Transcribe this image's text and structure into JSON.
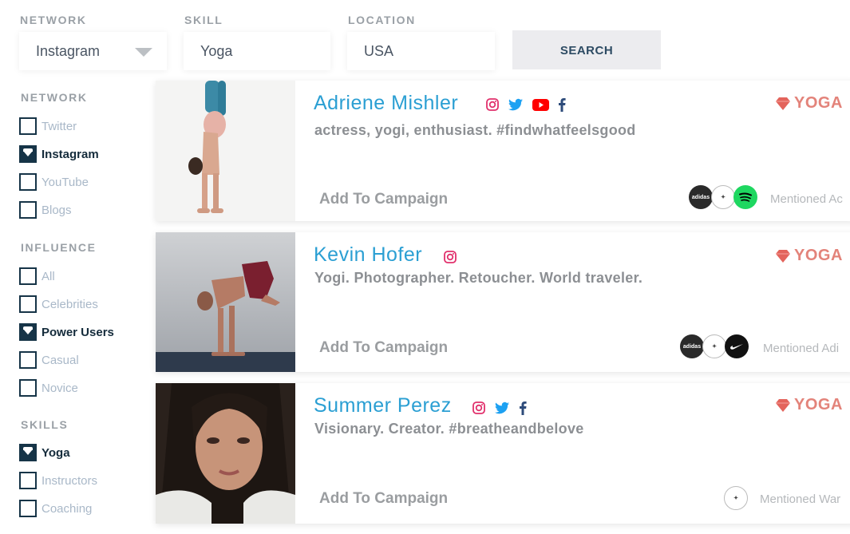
{
  "search": {
    "network_label": "NETWORK",
    "network_value": "Instagram",
    "skill_label": "SKILL",
    "skill_value": "Yoga",
    "location_label": "LOCATION",
    "location_value": "USA",
    "search_button": "SEARCH"
  },
  "sidebar": {
    "network": {
      "title": "NETWORK",
      "items": [
        {
          "label": "Twitter",
          "checked": false
        },
        {
          "label": "Instagram",
          "checked": true
        },
        {
          "label": "YouTube",
          "checked": false
        },
        {
          "label": "Blogs",
          "checked": false
        }
      ]
    },
    "influence": {
      "title": "INFLUENCE",
      "items": [
        {
          "label": "All",
          "checked": false
        },
        {
          "label": "Celebrities",
          "checked": false
        },
        {
          "label": "Power Users",
          "checked": true
        },
        {
          "label": "Casual",
          "checked": false
        },
        {
          "label": "Novice",
          "checked": false
        }
      ]
    },
    "skills": {
      "title": "SKILLS",
      "items": [
        {
          "label": "Yoga",
          "checked": true
        },
        {
          "label": "Instructors",
          "checked": false
        },
        {
          "label": "Coaching",
          "checked": false
        }
      ]
    }
  },
  "cards": [
    {
      "name": "Adriene Mishler",
      "bio": "actress, yogi, enthusiast. #findwhatfeelsgood",
      "tag": "YOGA",
      "add_label": "Add To Campaign",
      "mentioned": "Mentioned Ac",
      "socials": [
        "instagram-icon",
        "twitter-icon",
        "youtube-icon",
        "facebook-icon"
      ],
      "brands": [
        "adidas-logo",
        "brand-seal-logo",
        "spotify-logo"
      ]
    },
    {
      "name": "Kevin Hofer",
      "bio": "Yogi. Photographer. Retoucher. World traveler.",
      "tag": "YOGA",
      "add_label": "Add To Campaign",
      "mentioned": "Mentioned Adi",
      "socials": [
        "instagram-icon"
      ],
      "brands": [
        "adidas-logo",
        "brand-seal-logo",
        "nike-logo"
      ]
    },
    {
      "name": "Summer Perez",
      "bio": "Visionary. Creator. #breatheandbelove",
      "tag": "YOGA",
      "add_label": "Add To Campaign",
      "mentioned": "Mentioned War",
      "socials": [
        "instagram-icon",
        "twitter-icon",
        "facebook-icon"
      ],
      "brands": [
        "brand-seal-logo"
      ]
    }
  ],
  "colors": {
    "accent": "#2b9fd3",
    "tag": "#e3837a",
    "checkbox": "#163447",
    "instagram": "#e1306c",
    "twitter": "#1da1f2",
    "youtube": "#ff0000",
    "facebook": "#2d4b7a",
    "spotify": "#1ed760"
  }
}
